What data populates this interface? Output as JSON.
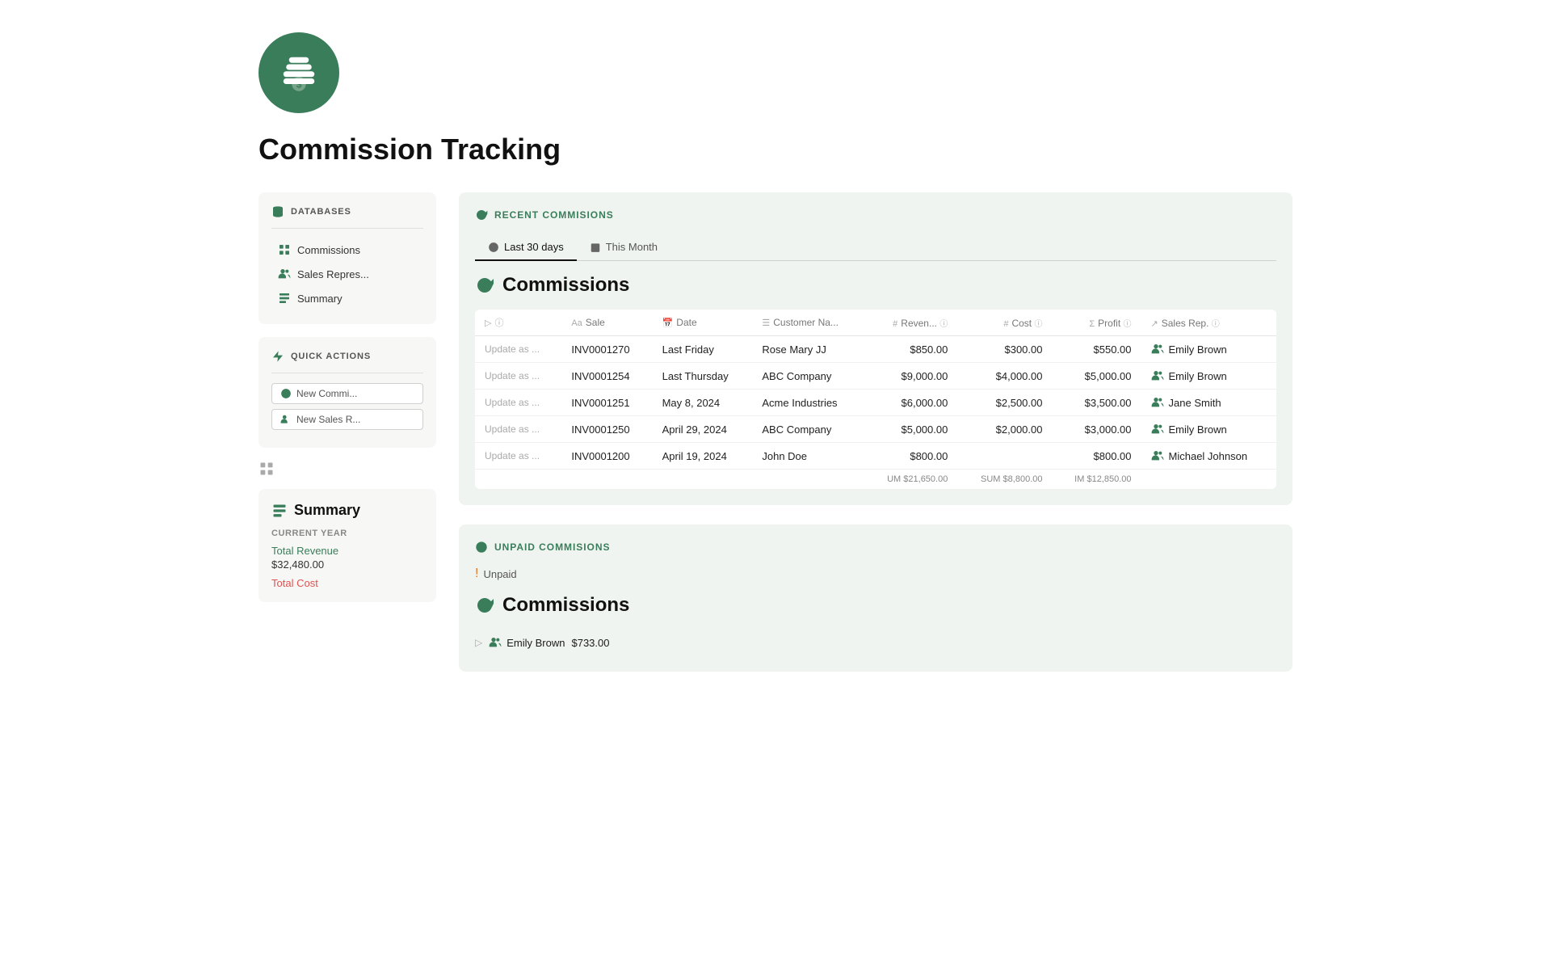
{
  "app": {
    "title": "Commission Tracking"
  },
  "sidebar": {
    "databases_label": "DATABASES",
    "items": [
      {
        "id": "commissions",
        "label": "Commissions"
      },
      {
        "id": "sales-reps",
        "label": "Sales Repres..."
      },
      {
        "id": "summary",
        "label": "Summary"
      }
    ],
    "quick_actions_label": "QUICK ACTIONS",
    "quick_actions": [
      {
        "id": "new-commission",
        "label": "New Commi..."
      },
      {
        "id": "new-sales-rep",
        "label": "New Sales R..."
      }
    ]
  },
  "summary_section": {
    "title": "Summary",
    "table_header": "CURRENT YEAR",
    "rows": [
      {
        "label": "Total Revenue",
        "value": "$32,480.00",
        "color": "green"
      },
      {
        "label": "Total Cost",
        "value": "",
        "color": "red"
      }
    ]
  },
  "recent_commissions": {
    "panel_title": "RECENT COMMISIONS",
    "tabs": [
      {
        "id": "last-30-days",
        "label": "Last 30 days",
        "active": true
      },
      {
        "id": "this-month",
        "label": "This Month",
        "active": false
      }
    ],
    "table_title": "Commissions",
    "columns": [
      {
        "id": "status",
        "label": ""
      },
      {
        "id": "sale",
        "label": "Sale",
        "prefix": "Aa"
      },
      {
        "id": "date",
        "label": "Date"
      },
      {
        "id": "customer",
        "label": "Customer Na..."
      },
      {
        "id": "revenue",
        "label": "Reven..."
      },
      {
        "id": "cost",
        "label": "Cost"
      },
      {
        "id": "profit",
        "label": "Profit"
      },
      {
        "id": "sales_rep",
        "label": "Sales Rep."
      }
    ],
    "rows": [
      {
        "update_as": "Update as ...",
        "sale": "INV0001270",
        "date": "Last Friday",
        "customer": "Rose Mary JJ",
        "revenue": "$850.00",
        "cost": "$300.00",
        "profit": "$550.00",
        "sales_rep": "Emily Brown"
      },
      {
        "update_as": "Update as ...",
        "sale": "INV0001254",
        "date": "Last Thursday",
        "customer": "ABC Company",
        "revenue": "$9,000.00",
        "cost": "$4,000.00",
        "profit": "$5,000.00",
        "sales_rep": "Emily Brown"
      },
      {
        "update_as": "Update as ...",
        "sale": "INV0001251",
        "date": "May 8, 2024",
        "customer": "Acme Industries",
        "revenue": "$6,000.00",
        "cost": "$2,500.00",
        "profit": "$3,500.00",
        "sales_rep": "Jane Smith"
      },
      {
        "update_as": "Update as ...",
        "sale": "INV0001250",
        "date": "April 29, 2024",
        "customer": "ABC Company",
        "revenue": "$5,000.00",
        "cost": "$2,000.00",
        "profit": "$3,000.00",
        "sales_rep": "Emily Brown"
      },
      {
        "update_as": "Update as ...",
        "sale": "INV0001200",
        "date": "April 19, 2024",
        "customer": "John Doe",
        "revenue": "$800.00",
        "cost": "",
        "profit": "$800.00",
        "sales_rep": "Michael Johnson"
      }
    ],
    "sum_row": {
      "revenue_label": "UM",
      "revenue_value": "$21,650.00",
      "cost_label": "SUM",
      "cost_value": "$8,800.00",
      "profit_label": "IM",
      "profit_value": "$12,850.00"
    }
  },
  "unpaid_commissions": {
    "panel_title": "UNPAID COMMISIONS",
    "filter_label": "Unpaid",
    "table_title": "Commissions",
    "unpaid_row": {
      "person": "Emily Brown",
      "amount": "$733.00"
    }
  },
  "colors": {
    "green": "#3a7d5a",
    "red": "#e05252",
    "panel_bg": "#f0f4f0",
    "sidebar_bg": "#f7f7f5"
  }
}
